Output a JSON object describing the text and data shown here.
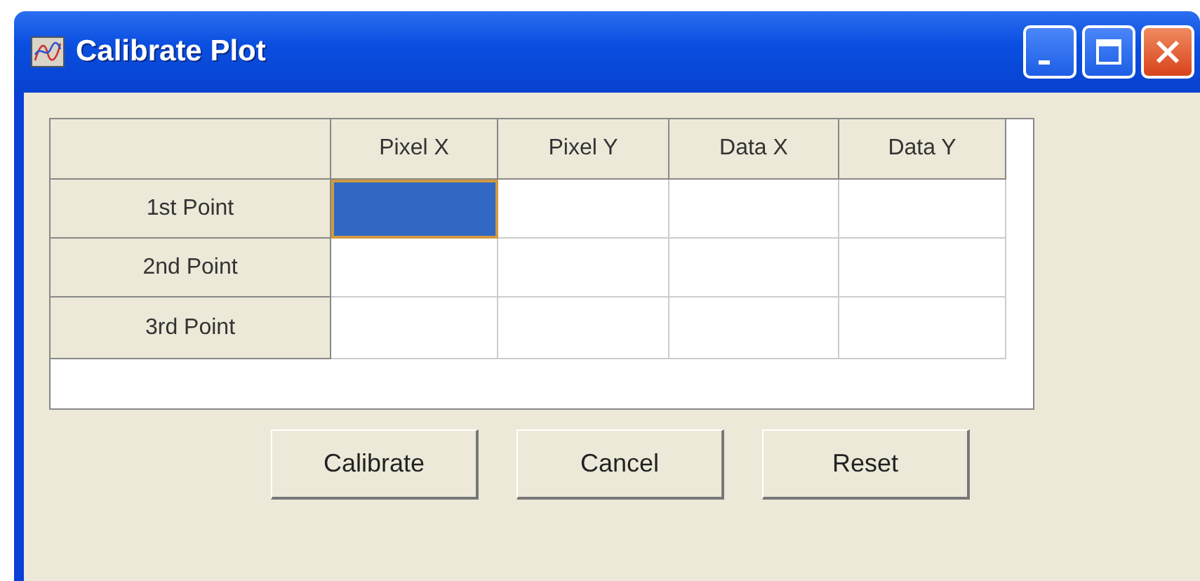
{
  "window": {
    "title": "Calibrate Plot"
  },
  "table": {
    "columns": [
      "Pixel X",
      "Pixel Y",
      "Data X",
      "Data Y"
    ],
    "rows": [
      {
        "label": "1st Point",
        "cells": [
          {
            "selected": true
          },
          {
            "selected": false
          },
          {
            "selected": false
          },
          {
            "selected": false
          }
        ]
      },
      {
        "label": "2nd Point",
        "cells": [
          {
            "selected": false
          },
          {
            "selected": false
          },
          {
            "selected": false
          },
          {
            "selected": false
          }
        ]
      },
      {
        "label": "3rd Point",
        "cells": [
          {
            "selected": false
          },
          {
            "selected": false
          },
          {
            "selected": false
          },
          {
            "selected": false
          }
        ]
      }
    ]
  },
  "buttons": [
    "Calibrate",
    "Cancel",
    "Reset"
  ]
}
